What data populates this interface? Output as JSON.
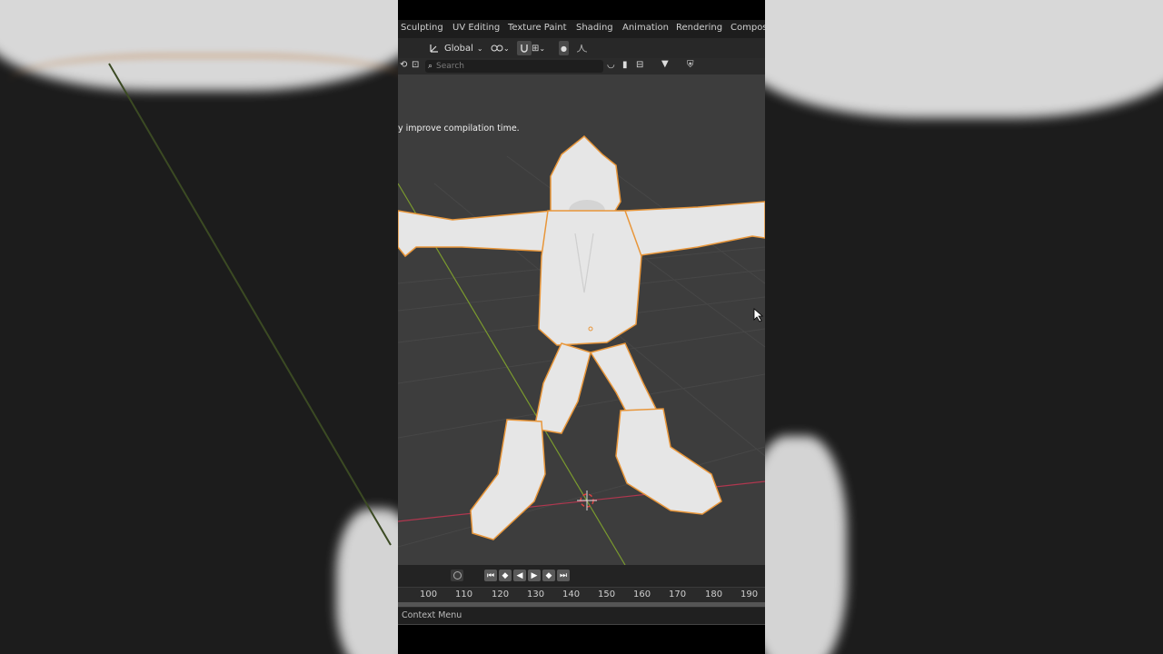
{
  "workspace_tabs": [
    "Sculpting",
    "UV Editing",
    "Texture Paint",
    "Shading",
    "Animation",
    "Rendering",
    "Composi"
  ],
  "header": {
    "transform_orientation": "Global"
  },
  "outliner": {
    "search_placeholder": "Search"
  },
  "viewport": {
    "notice": "y improve compilation time."
  },
  "timeline": {
    "frame_ticks": [
      "100",
      "110",
      "120",
      "130",
      "140",
      "150",
      "160",
      "170",
      "180",
      "190"
    ]
  },
  "status_bar": {
    "hint": "Context Menu"
  },
  "colors": {
    "viewport_bg": "#3d3d3d",
    "x_axis": "#b0374f",
    "y_axis": "#7a9a2e",
    "selection_outline": "#e8963a",
    "model": "#e6e6e6"
  },
  "icons": [
    "orientation-icon",
    "dropdown-icon",
    "snap-icon",
    "proportional-icon",
    "search-icon",
    "filter-icon",
    "cursor-icon",
    "play-icon",
    "3d-cursor-icon"
  ]
}
